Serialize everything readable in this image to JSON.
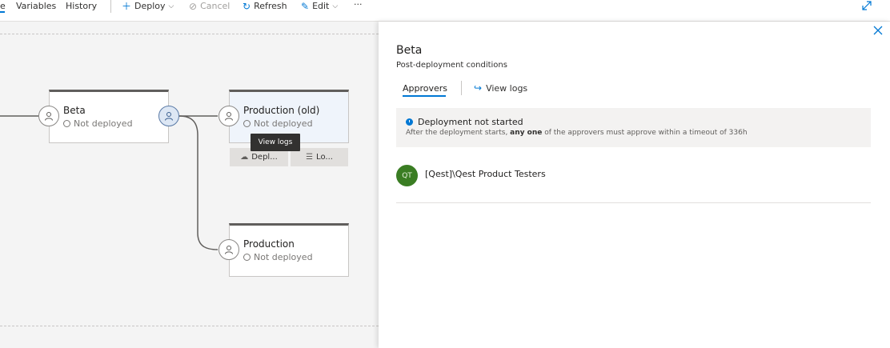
{
  "toolbar": {
    "active_tab": "e",
    "variables": "Variables",
    "history": "History",
    "deploy": "Deploy",
    "cancel": "Cancel",
    "refresh": "Refresh",
    "edit": "Edit",
    "more": "···"
  },
  "pipeline": {
    "stages": [
      {
        "name": "Beta",
        "status": "Not deployed"
      },
      {
        "name": "Production (old)",
        "status": "Not deployed",
        "actions": [
          "Depl...",
          "Lo..."
        ]
      },
      {
        "name": "Production",
        "status": "Not deployed"
      }
    ],
    "tooltip": "View logs"
  },
  "panel": {
    "title": "Beta",
    "subtitle": "Post-deployment conditions",
    "tabs": {
      "approvers": "Approvers",
      "view_logs": "View logs"
    },
    "info": {
      "title": "Deployment not started",
      "text_before": "After the deployment starts, ",
      "text_bold": "any one",
      "text_after": " of the approvers must approve within a timeout of 336h"
    },
    "approver": {
      "initials": "QT",
      "name": "[Qest]\\Qest Product Testers"
    }
  },
  "colors": {
    "accent": "#0078d4",
    "avatar_green": "#3a7d23"
  },
  "icons": [
    "plus-icon",
    "chevron-down-icon",
    "cancel-icon",
    "refresh-icon",
    "pencil-icon",
    "expand-icon",
    "close-icon",
    "approver-person-icon",
    "cloud-icon",
    "logs-icon",
    "info-icon",
    "redirect-icon"
  ]
}
